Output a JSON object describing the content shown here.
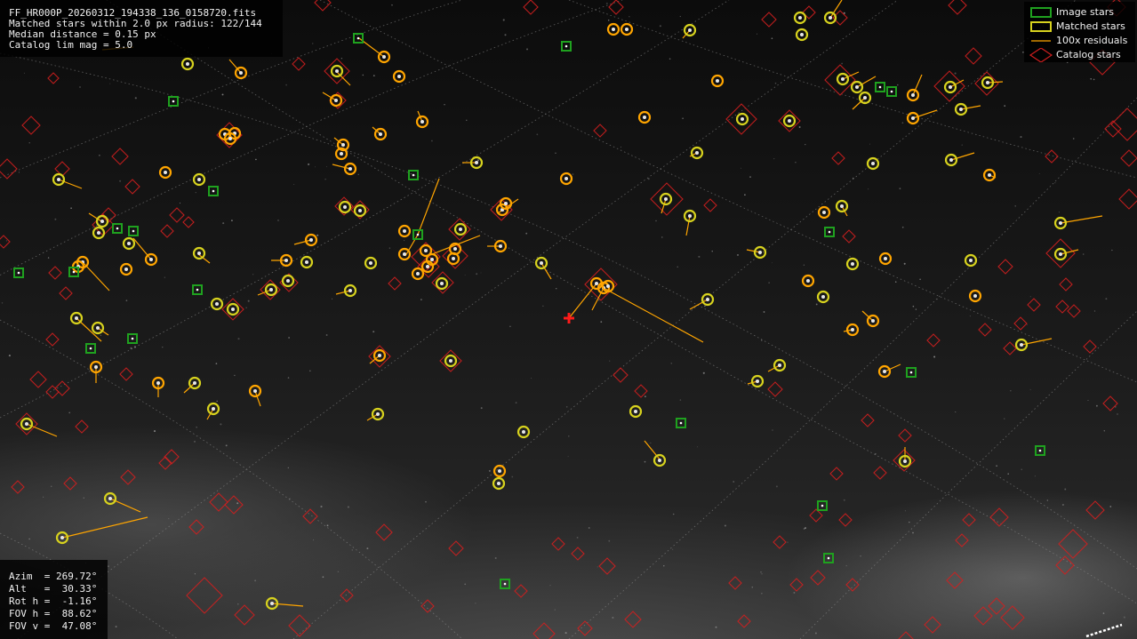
{
  "info": {
    "filename": "FF_HR000P_20260312_194338_136_0158720.fits",
    "matched_line": "Matched stars within 2.0 px radius: 122/144",
    "median_line": "Median distance = 0.15 px",
    "limmag_line": "Catalog lim mag = 5.0"
  },
  "pointing": {
    "azim": "Azim  = 269.72°",
    "alt": "Alt   =  30.33°",
    "rot": "Rot h =  -1.16°",
    "fov_h": "FOV h =  88.62°",
    "fov_v": "FOV v =  47.08°"
  },
  "legend": {
    "image_stars": "Image stars",
    "matched_stars": "Matched stars",
    "residuals": "100x residuals",
    "catalog_stars": "Catalog stars"
  },
  "colors": {
    "image_star": "#1fa11f",
    "matched_star": "#d7d21e",
    "residual": "#ffa500",
    "catalog_star": "#d01f1f",
    "grid": "#8a8a8a",
    "centre_marker": "#ff1a1a"
  },
  "icons": {
    "image_star": "green-square-icon",
    "matched_star": "yellow-orange-ring-icon",
    "residual": "orange-line-icon",
    "catalog_star": "red-diamond-icon",
    "centre": "red-cross-icon"
  }
}
